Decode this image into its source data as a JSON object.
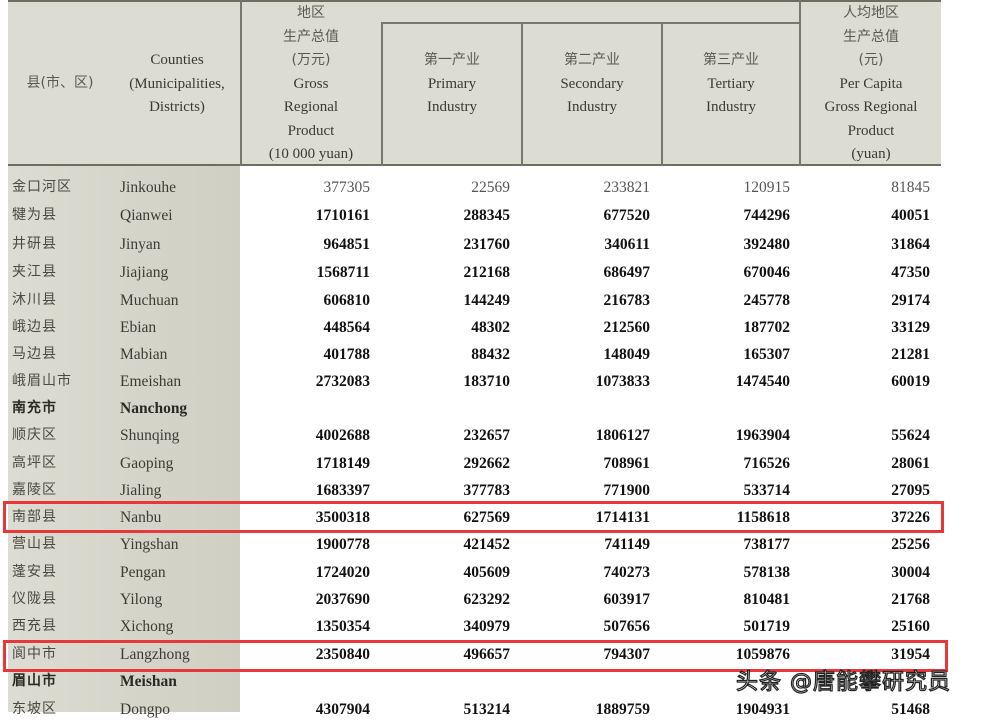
{
  "header": {
    "col_county_zh": "县(市、区)",
    "col_county_en": [
      "Counties",
      "(Municipalities,",
      "Districts)"
    ],
    "col_grp": [
      "地区",
      "生产总值",
      "(万元)",
      "Gross",
      "Regional",
      "Product",
      "(10 000 yuan)"
    ],
    "col_primary": [
      "第一产业",
      "Primary",
      "Industry"
    ],
    "col_secondary": [
      "第二产业",
      "Secondary",
      "Industry"
    ],
    "col_tertiary": [
      "第三产业",
      "Tertiary",
      "Industry"
    ],
    "col_per_capita": [
      "人均地区",
      "生产总值",
      "(元)",
      "Per Capita",
      "Gross Regional",
      "Product",
      "(yuan)"
    ]
  },
  "rows": [
    {
      "zh": "金口河区",
      "en": "Jinkouhe",
      "grp": "377305",
      "primary": "22569",
      "secondary": "233821",
      "tertiary": "120915",
      "per_capita": "81845"
    },
    {
      "zh": "犍为县",
      "en": "Qianwei",
      "grp": "1710161",
      "primary": "288345",
      "secondary": "677520",
      "tertiary": "744296",
      "per_capita": "40051"
    },
    {
      "zh": "井研县",
      "en": "Jinyan",
      "grp": "964851",
      "primary": "231760",
      "secondary": "340611",
      "tertiary": "392480",
      "per_capita": "31864"
    },
    {
      "zh": "夹江县",
      "en": "Jiajiang",
      "grp": "1568711",
      "primary": "212168",
      "secondary": "686497",
      "tertiary": "670046",
      "per_capita": "47350"
    },
    {
      "zh": "沐川县",
      "en": "Muchuan",
      "grp": "606810",
      "primary": "144249",
      "secondary": "216783",
      "tertiary": "245778",
      "per_capita": "29174"
    },
    {
      "zh": "峨边县",
      "en": "Ebian",
      "grp": "448564",
      "primary": "48302",
      "secondary": "212560",
      "tertiary": "187702",
      "per_capita": "33129"
    },
    {
      "zh": "马边县",
      "en": "Mabian",
      "grp": "401788",
      "primary": "88432",
      "secondary": "148049",
      "tertiary": "165307",
      "per_capita": "21281"
    },
    {
      "zh": "峨眉山市",
      "en": "Emeishan",
      "grp": "2732083",
      "primary": "183710",
      "secondary": "1073833",
      "tertiary": "1474540",
      "per_capita": "60019"
    },
    {
      "zh": "南充市",
      "en": "Nanchong",
      "grp": "",
      "primary": "",
      "secondary": "",
      "tertiary": "",
      "per_capita": "",
      "group": true
    },
    {
      "zh": "顺庆区",
      "en": "Shunqing",
      "grp": "4002688",
      "primary": "232657",
      "secondary": "1806127",
      "tertiary": "1963904",
      "per_capita": "55624"
    },
    {
      "zh": "高坪区",
      "en": "Gaoping",
      "grp": "1718149",
      "primary": "292662",
      "secondary": "708961",
      "tertiary": "716526",
      "per_capita": "28061"
    },
    {
      "zh": "嘉陵区",
      "en": "Jialing",
      "grp": "1683397",
      "primary": "377783",
      "secondary": "771900",
      "tertiary": "533714",
      "per_capita": "27095"
    },
    {
      "zh": "南部县",
      "en": "Nanbu",
      "grp": "3500318",
      "primary": "627569",
      "secondary": "1714131",
      "tertiary": "1158618",
      "per_capita": "37226",
      "highlighted": true
    },
    {
      "zh": "营山县",
      "en": "Yingshan",
      "grp": "1900778",
      "primary": "421452",
      "secondary": "741149",
      "tertiary": "738177",
      "per_capita": "25256"
    },
    {
      "zh": "蓬安县",
      "en": "Pengan",
      "grp": "1724020",
      "primary": "405609",
      "secondary": "740273",
      "tertiary": "578138",
      "per_capita": "30004"
    },
    {
      "zh": "仪陇县",
      "en": "Yilong",
      "grp": "2037690",
      "primary": "623292",
      "secondary": "603917",
      "tertiary": "810481",
      "per_capita": "21768"
    },
    {
      "zh": "西充县",
      "en": "Xichong",
      "grp": "1350354",
      "primary": "340979",
      "secondary": "507656",
      "tertiary": "501719",
      "per_capita": "25160"
    },
    {
      "zh": "阆中市",
      "en": "Langzhong",
      "grp": "2350840",
      "primary": "496657",
      "secondary": "794307",
      "tertiary": "1059876",
      "per_capita": "31954",
      "highlighted": true
    },
    {
      "zh": "眉山市",
      "en": "Meishan",
      "grp": "",
      "primary": "",
      "secondary": "",
      "tertiary": "",
      "per_capita": "",
      "group": true
    },
    {
      "zh": "东坡区",
      "en": "Dongpo",
      "grp": "4307904",
      "primary": "513214",
      "secondary": "1889759",
      "tertiary": "1904931",
      "per_capita": "51468"
    }
  ],
  "highlight_color": "#e8373b",
  "watermark": "头条 @唐能攀研究员"
}
